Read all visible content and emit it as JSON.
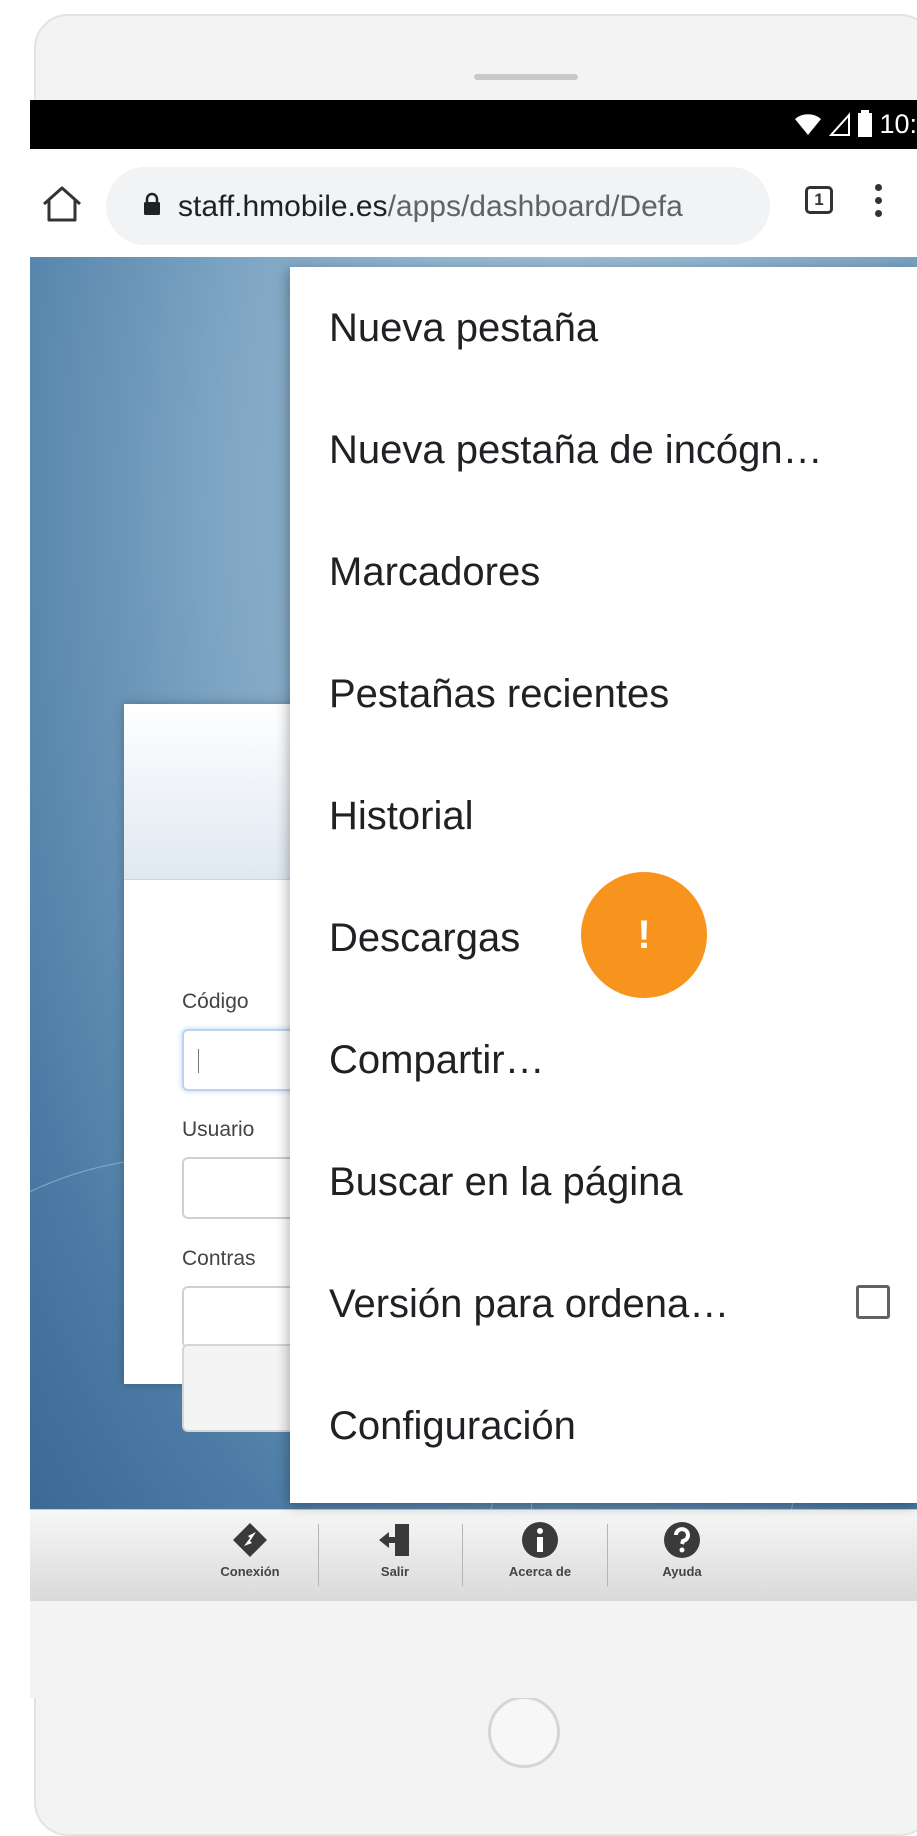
{
  "status_bar": {
    "time": "10:"
  },
  "browser": {
    "url_host": "staff.hmobile.es",
    "url_path": "/apps/dashboard/Defa",
    "tab_count": "1"
  },
  "menu": {
    "items": [
      {
        "label": "Nueva pestaña"
      },
      {
        "label": "Nueva pestaña de incógn…"
      },
      {
        "label": "Marcadores"
      },
      {
        "label": "Pestañas recientes"
      },
      {
        "label": "Historial"
      },
      {
        "label": "Descargas"
      },
      {
        "label": "Compartir…"
      },
      {
        "label": "Buscar en la página"
      },
      {
        "label": "Versión para ordena…",
        "checkbox": false
      },
      {
        "label": "Configuración"
      }
    ]
  },
  "login_form": {
    "code_label": "Código",
    "user_label": "Usuario",
    "password_label": "Contras"
  },
  "bottom_bar": {
    "items": [
      {
        "label": "Conexión",
        "icon": "connection-icon"
      },
      {
        "label": "Salir",
        "icon": "exit-door-icon"
      },
      {
        "label": "Acerca de",
        "icon": "info-icon"
      },
      {
        "label": "Ayuda",
        "icon": "help-icon"
      }
    ]
  },
  "badge": {
    "text": "!",
    "color": "#f7941d"
  }
}
